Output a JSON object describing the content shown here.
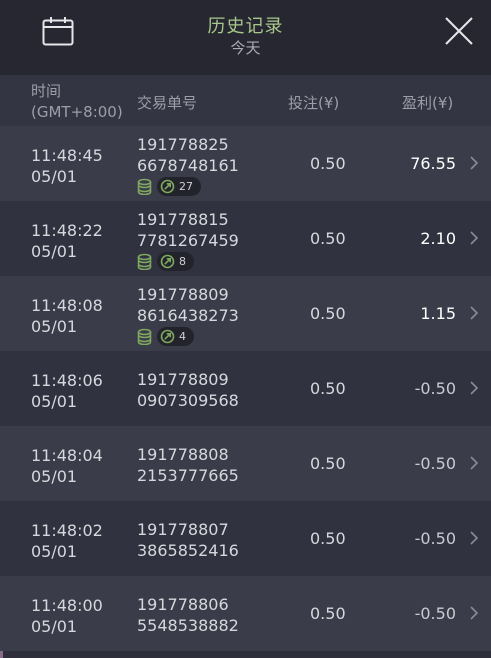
{
  "header": {
    "title": "历史记录",
    "subtitle": "今天"
  },
  "columns": {
    "time_line1": "时间",
    "time_line2": "(GMT+8:00)",
    "order": "交易单号",
    "bet": "投注(¥)",
    "profit": "盈利(¥)"
  },
  "rows": [
    {
      "time": "11:48:45",
      "date": "05/01",
      "order1": "191778825",
      "order2": "6678748161",
      "bet": "0.50",
      "profit": "76.55",
      "badge": "27"
    },
    {
      "time": "11:48:22",
      "date": "05/01",
      "order1": "191778815",
      "order2": "7781267459",
      "bet": "0.50",
      "profit": "2.10",
      "badge": "8"
    },
    {
      "time": "11:48:08",
      "date": "05/01",
      "order1": "191778809",
      "order2": "8616438273",
      "bet": "0.50",
      "profit": "1.15",
      "badge": "4"
    },
    {
      "time": "11:48:06",
      "date": "05/01",
      "order1": "191778809",
      "order2": "0907309568",
      "bet": "0.50",
      "profit": "-0.50"
    },
    {
      "time": "11:48:04",
      "date": "05/01",
      "order1": "191778808",
      "order2": "2153777665",
      "bet": "0.50",
      "profit": "-0.50"
    },
    {
      "time": "11:48:02",
      "date": "05/01",
      "order1": "191778807",
      "order2": "3865852416",
      "bet": "0.50",
      "profit": "-0.50"
    },
    {
      "time": "11:48:00",
      "date": "05/01",
      "order1": "191778806",
      "order2": "5548538882",
      "bet": "0.50",
      "profit": "-0.50"
    }
  ],
  "colors": {
    "title": "#a8c78b",
    "positive_profit": "#ffffff",
    "badge_icon": "#7fa860"
  },
  "icons": {
    "calendar": "calendar-icon",
    "close": "close-icon",
    "chevron": "chevron-right-icon",
    "coins": "coins-icon",
    "arrow": "arrow-circle-icon"
  }
}
